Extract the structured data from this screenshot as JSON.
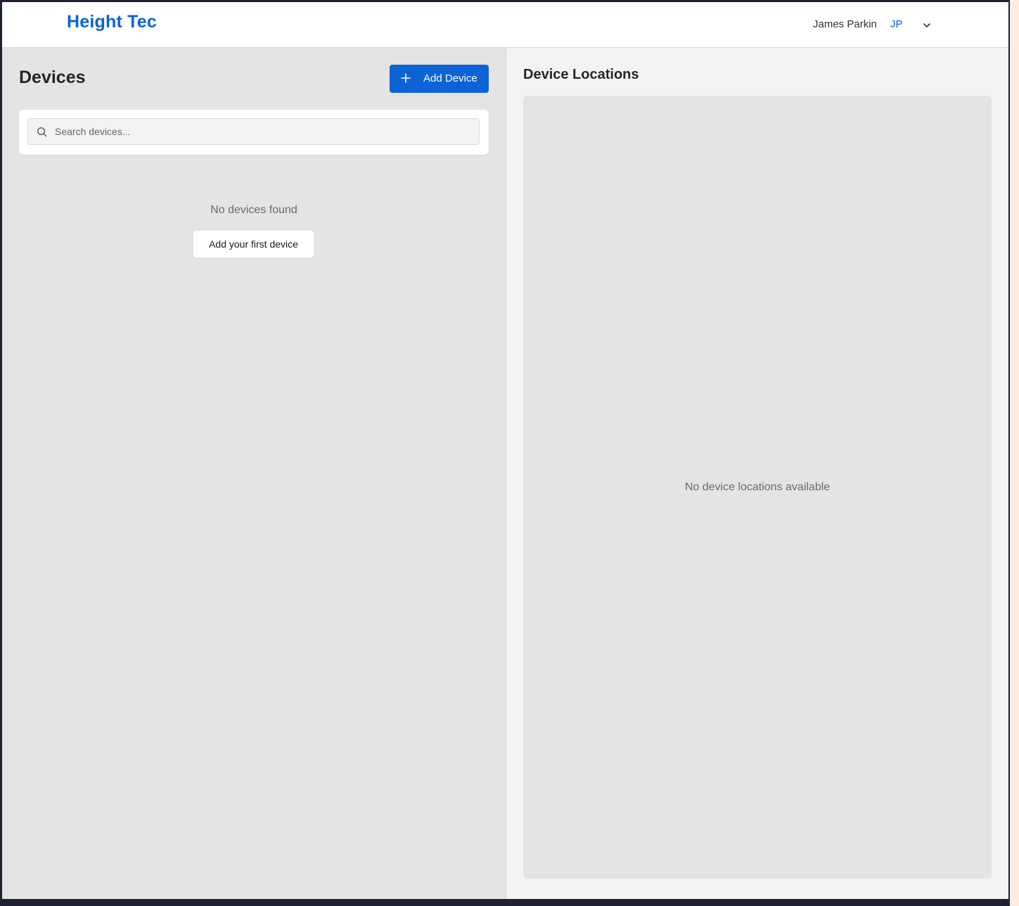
{
  "header": {
    "brand": "Height Tec",
    "user_name": "James Parkin",
    "avatar_initials": "JP",
    "menu_icon": "chevron-down-icon"
  },
  "devices": {
    "title": "Devices",
    "add_button_label": "Add Device",
    "add_button_icon": "plus-icon",
    "search": {
      "placeholder": "Search devices...",
      "value": "",
      "icon": "search-icon"
    },
    "empty_message": "No devices found",
    "empty_action_label": "Add your first device"
  },
  "locations": {
    "title": "Device Locations",
    "empty_message": "No device locations available"
  },
  "colors": {
    "accent": "#0b63d6",
    "panel_bg": "#e4e4e4",
    "right_bg": "#f3f3f3",
    "header_bg": "#ffffff"
  }
}
